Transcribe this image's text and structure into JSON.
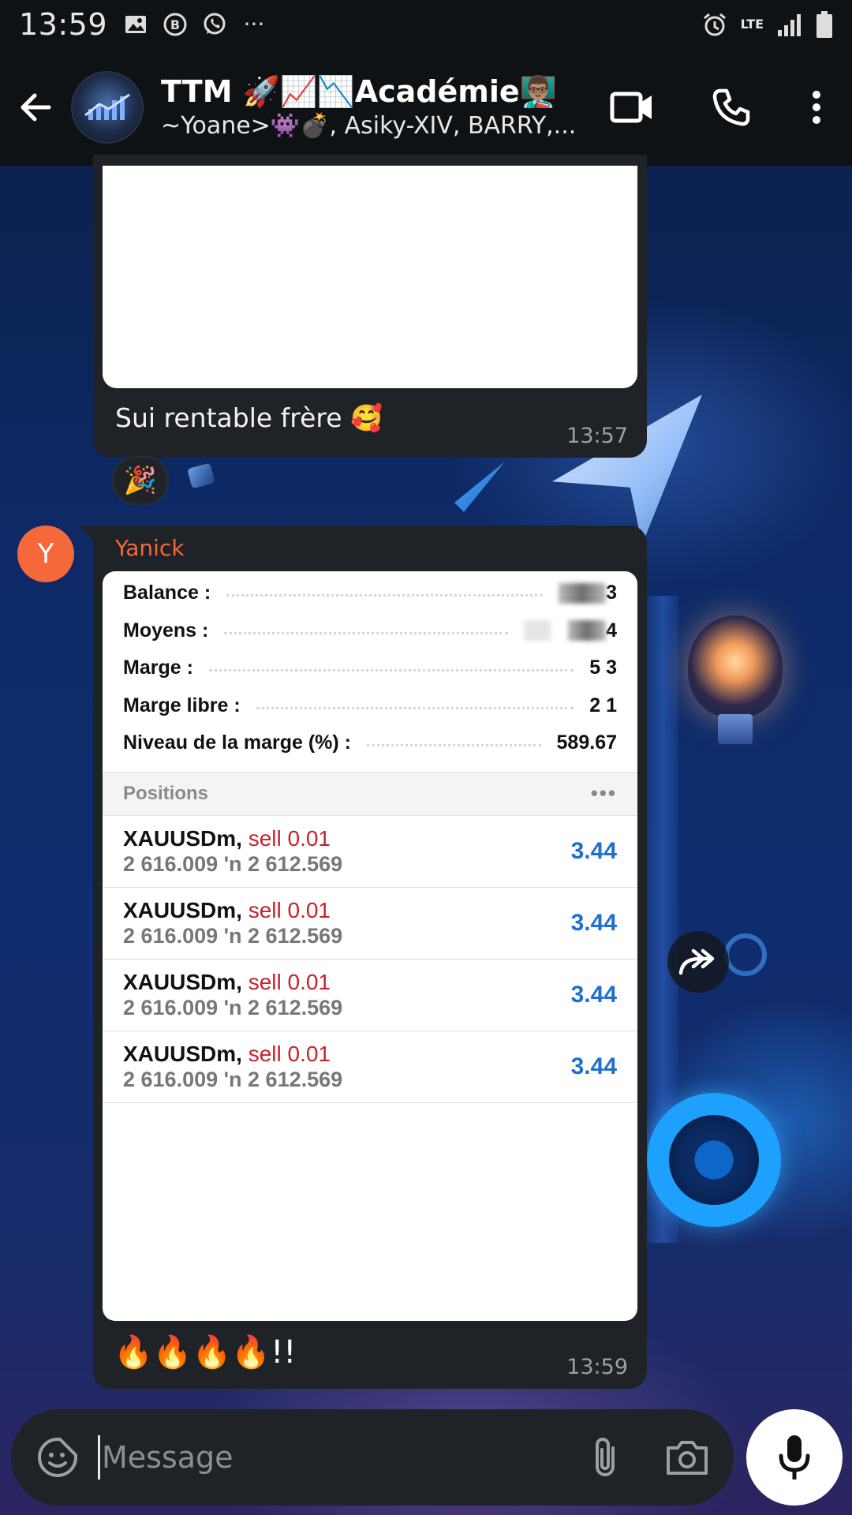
{
  "status_bar": {
    "time": "13:59",
    "network": "LTE"
  },
  "header": {
    "title": "TTM 🚀📈📉Académie👨🏽‍🏫",
    "subtitle": "~Yoane>👾💣, Asiky-XIV, BARRY,..."
  },
  "messages": [
    {
      "caption": "Sui rentable frère 🥰",
      "time": "13:57",
      "reaction": "🎉"
    },
    {
      "sender": "Yanick",
      "sender_initial": "Y",
      "screenshot": {
        "account": [
          {
            "label": "Balance :",
            "value": "3"
          },
          {
            "label": "Moyens :",
            "value": "4"
          },
          {
            "label": "Marge :",
            "value": "5 3"
          },
          {
            "label": "Marge libre :",
            "value": "2 1"
          },
          {
            "label": "Niveau de la marge (%) :",
            "value": "589.67"
          }
        ],
        "positions_header": "Positions",
        "positions": [
          {
            "symbol": "XAUUSDm,",
            "side": "sell 0.01",
            "prices": "2 616.009 'n  2 612.569",
            "profit": "3.44"
          },
          {
            "symbol": "XAUUSDm,",
            "side": "sell 0.01",
            "prices": "2 616.009 'n  2 612.569",
            "profit": "3.44"
          },
          {
            "symbol": "XAUUSDm,",
            "side": "sell 0.01",
            "prices": "2 616.009 'n  2 612.569",
            "profit": "3.44"
          },
          {
            "symbol": "XAUUSDm,",
            "side": "sell 0.01",
            "prices": "2 616.009 'n  2 612.569",
            "profit": "3.44"
          }
        ]
      },
      "caption": "🔥🔥🔥🔥!!",
      "time": "13:59"
    }
  ],
  "composer": {
    "placeholder": "Message"
  },
  "colors": {
    "bar_bg": "#0f1215",
    "bubble_bg": "#1f2226",
    "sender_color": "#f4683a",
    "sell_red": "#c8222a",
    "profit_blue": "#1f6fd1"
  }
}
